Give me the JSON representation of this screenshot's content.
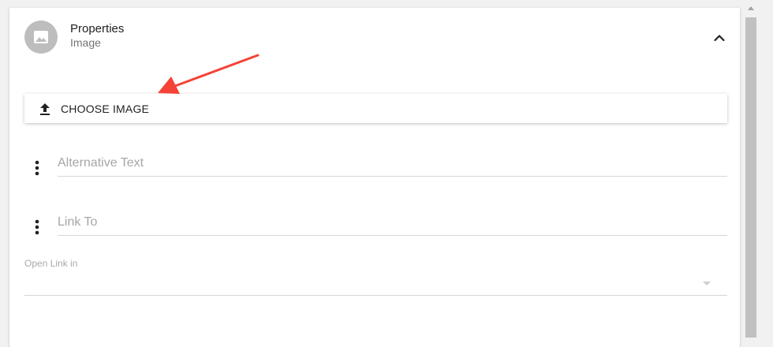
{
  "header": {
    "title": "Properties",
    "subtitle": "Image",
    "avatar_icon": "image-icon",
    "toggle_icon": "chevron-up-icon"
  },
  "choose_image": {
    "label": "CHOOSE IMAGE",
    "icon": "upload-icon"
  },
  "fields": {
    "alt_text": {
      "placeholder": "Alternative Text",
      "value": "",
      "menu_icon": "more-vert-icon"
    },
    "link_to": {
      "placeholder": "Link To",
      "value": "",
      "menu_icon": "more-vert-icon"
    }
  },
  "open_link_in": {
    "label": "Open Link in",
    "value": "",
    "icon": "dropdown-caret-icon"
  },
  "annotation": {
    "icon": "red-arrow-icon",
    "color": "#f44336"
  },
  "colors": {
    "avatar": "#bdbdbd",
    "accent": "#f44336",
    "divider": "#d6d6d6"
  }
}
